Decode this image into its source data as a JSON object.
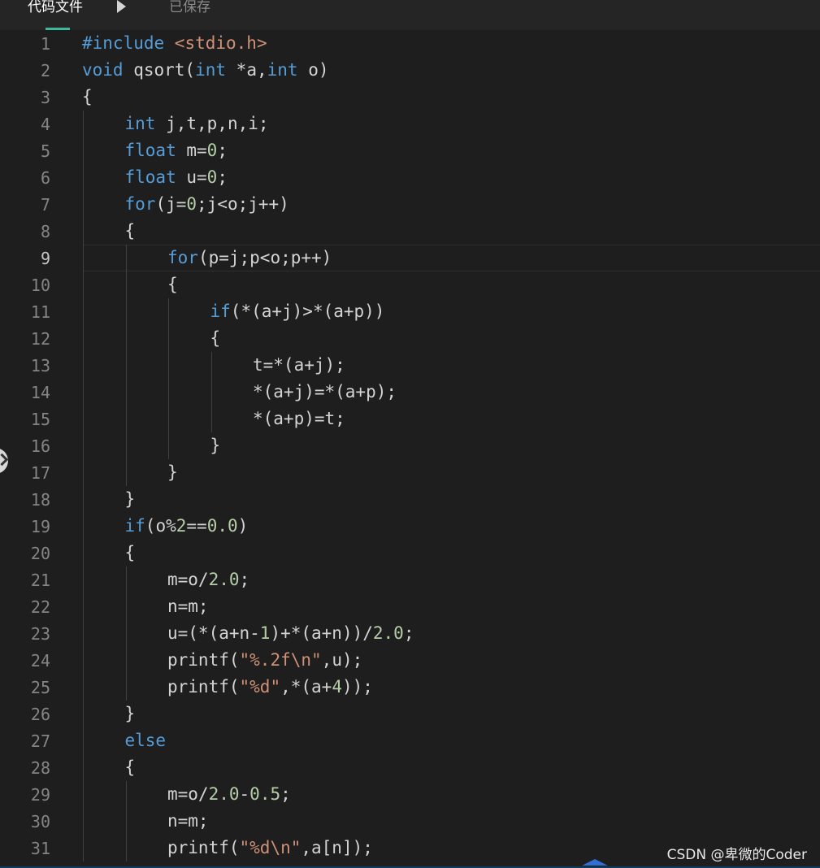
{
  "header": {
    "file_tab": "代码文件",
    "status": "已保存"
  },
  "watermark": "CSDN @卑微的Coder",
  "current_line": 9,
  "colors": {
    "background": "#1e1e1e",
    "keyword": "#569cd6",
    "number": "#b5cea8",
    "string": "#ce9178",
    "text": "#d4d4d4",
    "line_number": "#858585",
    "accent": "#3fb6a0"
  },
  "lines": [
    {
      "n": "1",
      "indent": 0,
      "tokens": [
        [
          "kw",
          "#include "
        ],
        [
          "inc",
          "<stdio.h>"
        ]
      ]
    },
    {
      "n": "2",
      "indent": 0,
      "tokens": [
        [
          "kw",
          "void"
        ],
        [
          "t",
          " qsort("
        ],
        [
          "kw",
          "int"
        ],
        [
          "t",
          " *a,"
        ],
        [
          "kw",
          "int"
        ],
        [
          "t",
          " o)"
        ]
      ]
    },
    {
      "n": "3",
      "indent": 0,
      "tokens": [
        [
          "t",
          "{"
        ]
      ]
    },
    {
      "n": "4",
      "indent": 1,
      "tokens": [
        [
          "kw",
          "int"
        ],
        [
          "t",
          " j,t,p,n,i;"
        ]
      ]
    },
    {
      "n": "5",
      "indent": 1,
      "tokens": [
        [
          "kw",
          "float"
        ],
        [
          "t",
          " m="
        ],
        [
          "num",
          "0"
        ],
        [
          "t",
          ";"
        ]
      ]
    },
    {
      "n": "6",
      "indent": 1,
      "tokens": [
        [
          "kw",
          "float"
        ],
        [
          "t",
          " u="
        ],
        [
          "num",
          "0"
        ],
        [
          "t",
          ";"
        ]
      ]
    },
    {
      "n": "7",
      "indent": 1,
      "tokens": [
        [
          "kw",
          "for"
        ],
        [
          "t",
          "(j="
        ],
        [
          "num",
          "0"
        ],
        [
          "t",
          ";j<o;j++)"
        ]
      ]
    },
    {
      "n": "8",
      "indent": 1,
      "tokens": [
        [
          "t",
          "{"
        ]
      ]
    },
    {
      "n": "9",
      "indent": 2,
      "tokens": [
        [
          "kw",
          "for"
        ],
        [
          "t",
          "(p=j;p<o;p++)"
        ]
      ]
    },
    {
      "n": "10",
      "indent": 2,
      "tokens": [
        [
          "t",
          "{"
        ]
      ]
    },
    {
      "n": "11",
      "indent": 3,
      "tokens": [
        [
          "kw",
          "if"
        ],
        [
          "t",
          "(*(a+j)>*(a+p))"
        ]
      ]
    },
    {
      "n": "12",
      "indent": 3,
      "tokens": [
        [
          "t",
          "{"
        ]
      ]
    },
    {
      "n": "13",
      "indent": 4,
      "tokens": [
        [
          "t",
          "t=*(a+j);"
        ]
      ]
    },
    {
      "n": "14",
      "indent": 4,
      "tokens": [
        [
          "t",
          "*(a+j)=*(a+p);"
        ]
      ]
    },
    {
      "n": "15",
      "indent": 4,
      "tokens": [
        [
          "t",
          "*(a+p)=t;"
        ]
      ]
    },
    {
      "n": "16",
      "indent": 3,
      "tokens": [
        [
          "t",
          "}"
        ]
      ]
    },
    {
      "n": "17",
      "indent": 2,
      "tokens": [
        [
          "t",
          "}"
        ]
      ]
    },
    {
      "n": "18",
      "indent": 1,
      "tokens": [
        [
          "t",
          "}"
        ]
      ]
    },
    {
      "n": "19",
      "indent": 1,
      "tokens": [
        [
          "kw",
          "if"
        ],
        [
          "t",
          "(o%"
        ],
        [
          "num",
          "2"
        ],
        [
          "t",
          "=="
        ],
        [
          "num",
          "0.0"
        ],
        [
          "t",
          ")"
        ]
      ]
    },
    {
      "n": "20",
      "indent": 1,
      "tokens": [
        [
          "t",
          "{"
        ]
      ]
    },
    {
      "n": "21",
      "indent": 2,
      "tokens": [
        [
          "t",
          "m=o/"
        ],
        [
          "num",
          "2.0"
        ],
        [
          "t",
          ";"
        ]
      ]
    },
    {
      "n": "22",
      "indent": 2,
      "tokens": [
        [
          "t",
          "n=m;"
        ]
      ]
    },
    {
      "n": "23",
      "indent": 2,
      "tokens": [
        [
          "t",
          "u=(*(a+n-"
        ],
        [
          "num",
          "1"
        ],
        [
          "t",
          ")+*(a+n))/"
        ],
        [
          "num",
          "2.0"
        ],
        [
          "t",
          ";"
        ]
      ]
    },
    {
      "n": "24",
      "indent": 2,
      "tokens": [
        [
          "t",
          "printf("
        ],
        [
          "str",
          "\"%.2f\\n\""
        ],
        [
          "t",
          ",u);"
        ]
      ]
    },
    {
      "n": "25",
      "indent": 2,
      "tokens": [
        [
          "t",
          "printf("
        ],
        [
          "str",
          "\"%d\""
        ],
        [
          "t",
          ",*(a+"
        ],
        [
          "num",
          "4"
        ],
        [
          "t",
          "));"
        ]
      ]
    },
    {
      "n": "26",
      "indent": 1,
      "tokens": [
        [
          "t",
          "}"
        ]
      ]
    },
    {
      "n": "27",
      "indent": 1,
      "tokens": [
        [
          "kw",
          "else"
        ]
      ]
    },
    {
      "n": "28",
      "indent": 1,
      "tokens": [
        [
          "t",
          "{"
        ]
      ]
    },
    {
      "n": "29",
      "indent": 2,
      "tokens": [
        [
          "t",
          "m=o/"
        ],
        [
          "num",
          "2.0"
        ],
        [
          "t",
          "-"
        ],
        [
          "num",
          "0.5"
        ],
        [
          "t",
          ";"
        ]
      ]
    },
    {
      "n": "30",
      "indent": 2,
      "tokens": [
        [
          "t",
          "n=m;"
        ]
      ]
    },
    {
      "n": "31",
      "indent": 2,
      "tokens": [
        [
          "t",
          "printf("
        ],
        [
          "str",
          "\"%d\\n\""
        ],
        [
          "t",
          ",a[n]);"
        ]
      ]
    }
  ]
}
